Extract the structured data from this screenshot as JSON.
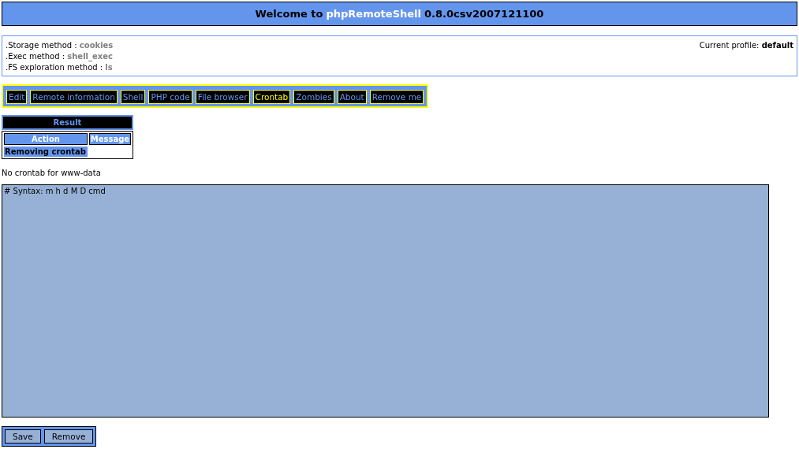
{
  "header": {
    "prefix": "Welcome to",
    "app": "phpRemoteShell",
    "version": "0.8.0csv2007121100"
  },
  "info": {
    "items": [
      {
        "label": ".Storage method :",
        "value": "cookies"
      },
      {
        "label": ".Exec method :",
        "value": "shell_exec"
      },
      {
        "label": ".FS exploration method :",
        "value": "ls"
      }
    ],
    "profile": {
      "label": "Current profile:",
      "value": "default"
    }
  },
  "nav": [
    {
      "label": "Edit",
      "selected": false
    },
    {
      "label": "Remote information",
      "selected": false
    },
    {
      "label": "Shell",
      "selected": false
    },
    {
      "label": "PHP code",
      "selected": false
    },
    {
      "label": "File browser",
      "selected": false
    },
    {
      "label": "Crontab",
      "selected": true
    },
    {
      "label": "Zombies",
      "selected": false
    },
    {
      "label": "About",
      "selected": false
    },
    {
      "label": "Remove me",
      "selected": false
    }
  ],
  "result": {
    "title": "Result",
    "columns": [
      "Action",
      "Message"
    ],
    "rows": [
      {
        "action": "Removing crontab"
      }
    ]
  },
  "message": "No crontab for www-data",
  "editor": {
    "value": "# Syntax: m h d M D cmd"
  },
  "buttons": [
    "Save",
    "Remove"
  ]
}
